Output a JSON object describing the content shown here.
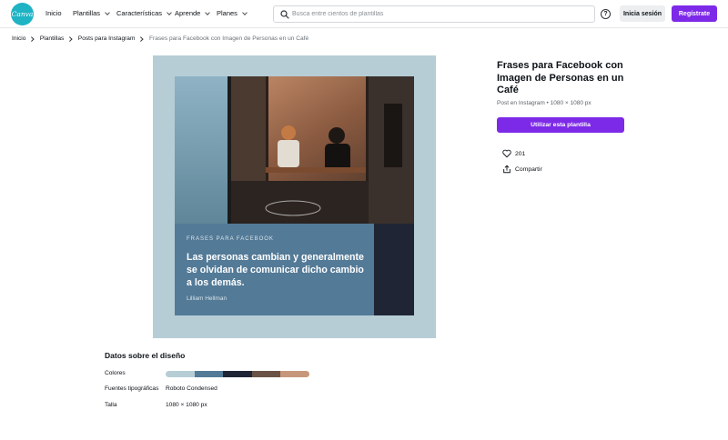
{
  "header": {
    "logo_text": "Canva",
    "nav": [
      {
        "label": "Inicio",
        "has_dropdown": false
      },
      {
        "label": "Plantillas",
        "has_dropdown": true
      },
      {
        "label": "Características",
        "has_dropdown": true
      },
      {
        "label": "Aprende",
        "has_dropdown": true
      },
      {
        "label": "Planes",
        "has_dropdown": true
      }
    ],
    "search_placeholder": "Busca entre cientos de plantillas",
    "help_icon": "question-circle-icon",
    "login_label": "Inicia sesión",
    "register_label": "Regístrate",
    "accent_color": "#7d2ae8",
    "logo_color": "#1fb3c4"
  },
  "breadcrumb": [
    "Inicio",
    "Plantillas",
    "Posts para Instagram",
    "Frases para Facebook con Imagen de Personas en un Café"
  ],
  "template": {
    "kicker": "FRASES PARA FACEBOOK",
    "quote": "Las personas cambian y generalmente se olvidan de comunicar dicho cambio a los demás.",
    "author": "Lilliam Hellman"
  },
  "info": {
    "title": "Frases para Facebook con Imagen de Personas en un Café",
    "subtitle": "Post en Instagram • 1080 × 1080 px",
    "use_button": "Utilizar esta plantilla",
    "likes": "201",
    "share_label": "Compartir"
  },
  "facts": {
    "title": "Datos sobre el diseño",
    "colors_label": "Colores",
    "colors": [
      "#b6cdd6",
      "#537a97",
      "#1f2535",
      "#6b5247",
      "#c7977c"
    ],
    "fonts_label": "Fuentes tipográficas",
    "fonts_value": "Roboto Condensed",
    "size_label": "Talla",
    "size_value": "1080 × 1080 px"
  }
}
